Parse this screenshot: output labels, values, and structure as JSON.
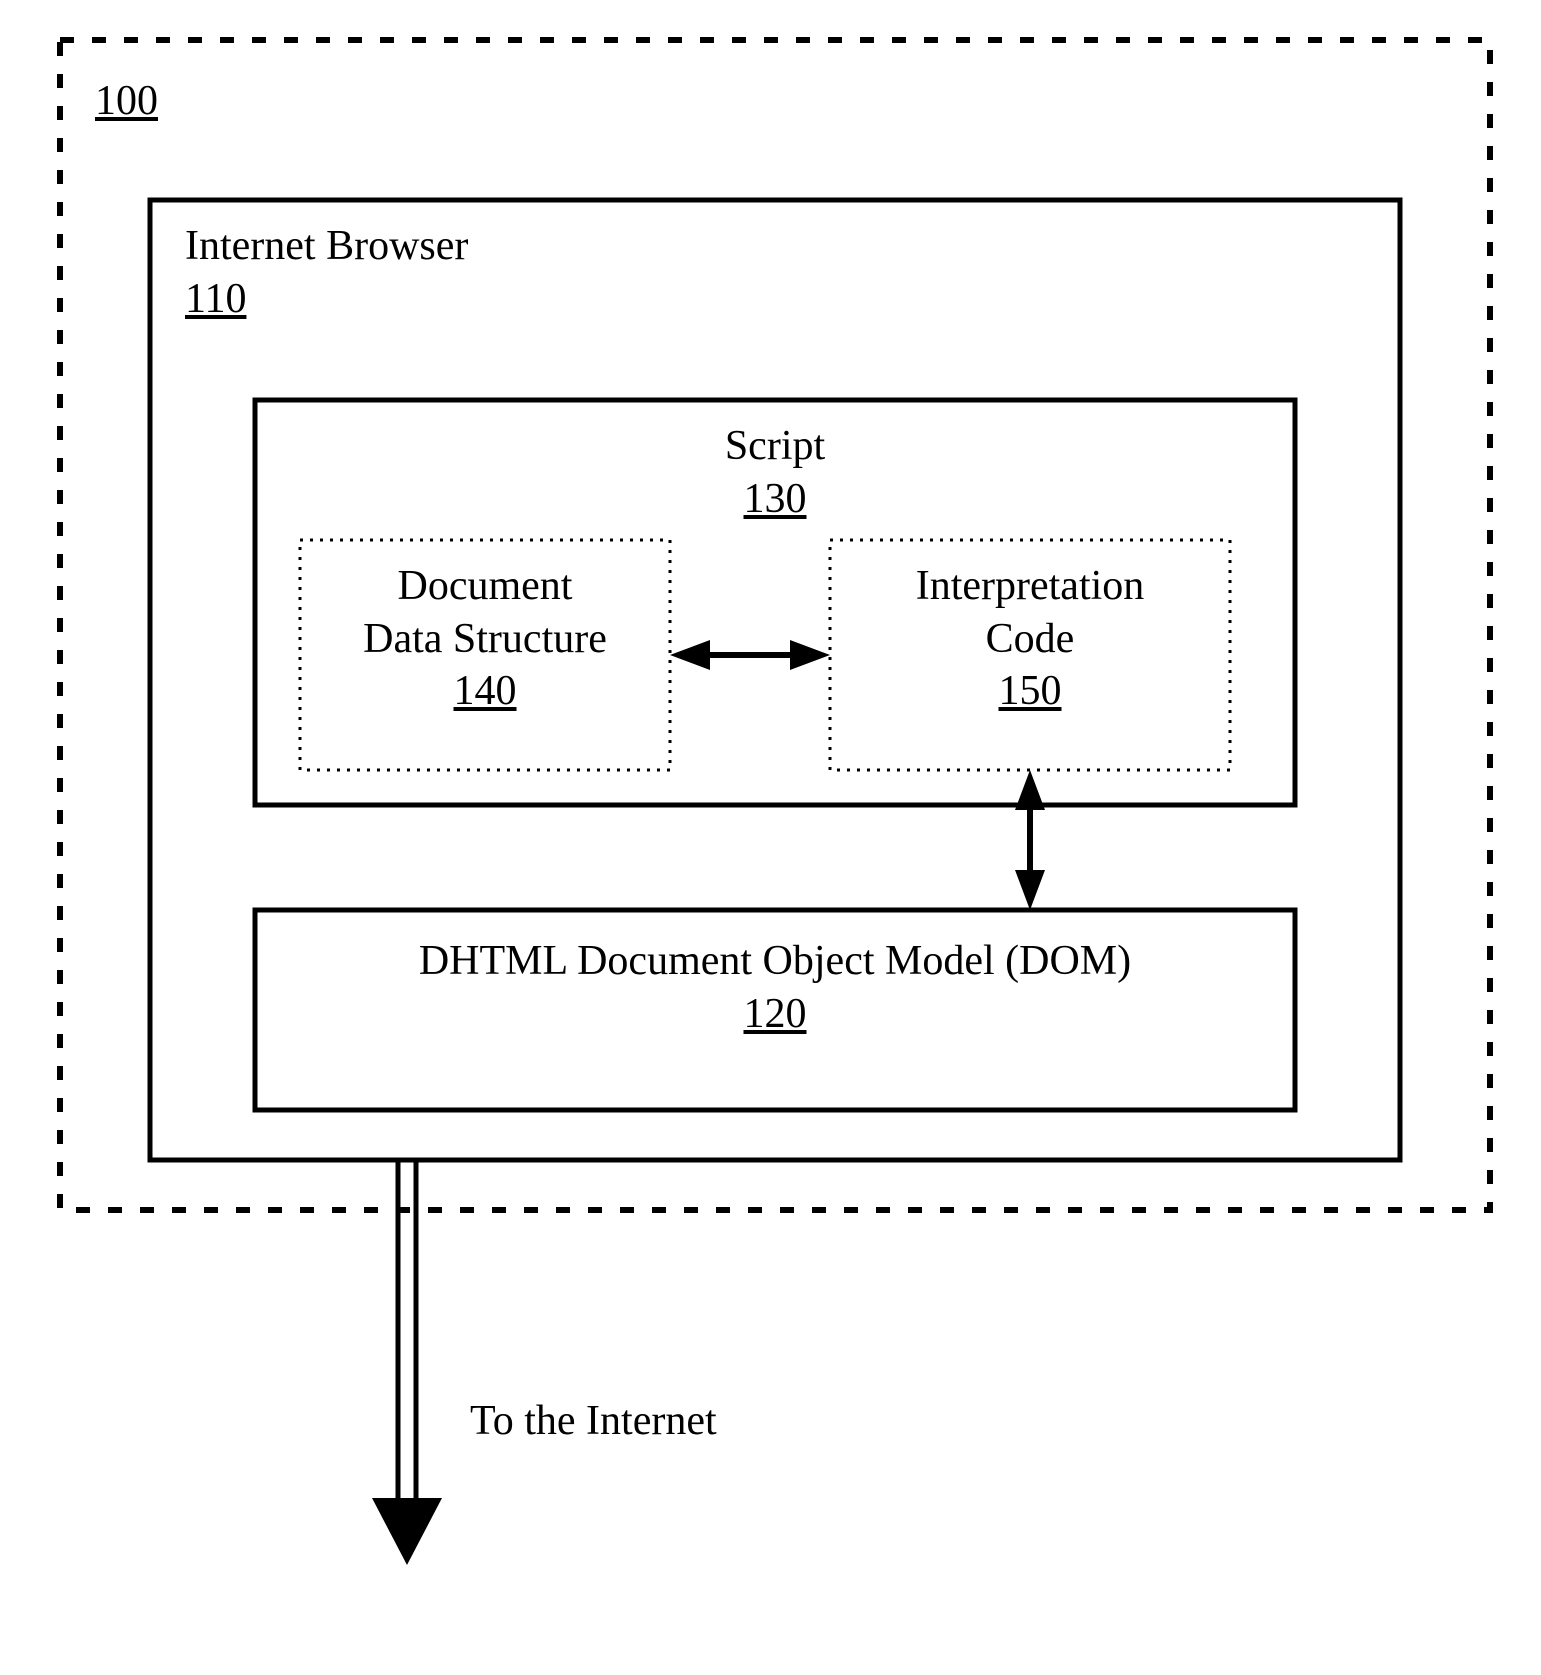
{
  "boxes": {
    "outer": {
      "ref": "100"
    },
    "browser": {
      "title": "Internet Browser",
      "ref": "110"
    },
    "script": {
      "title": "Script",
      "ref": "130"
    },
    "docdata": {
      "title_line1": "Document",
      "title_line2": "Data Structure",
      "ref": "140"
    },
    "interp": {
      "title_line1": "Interpretation",
      "title_line2": "Code",
      "ref": "150"
    },
    "dom": {
      "title": "DHTML Document Object Model (DOM)",
      "ref": "120"
    }
  },
  "arrow_label": "To the Internet"
}
